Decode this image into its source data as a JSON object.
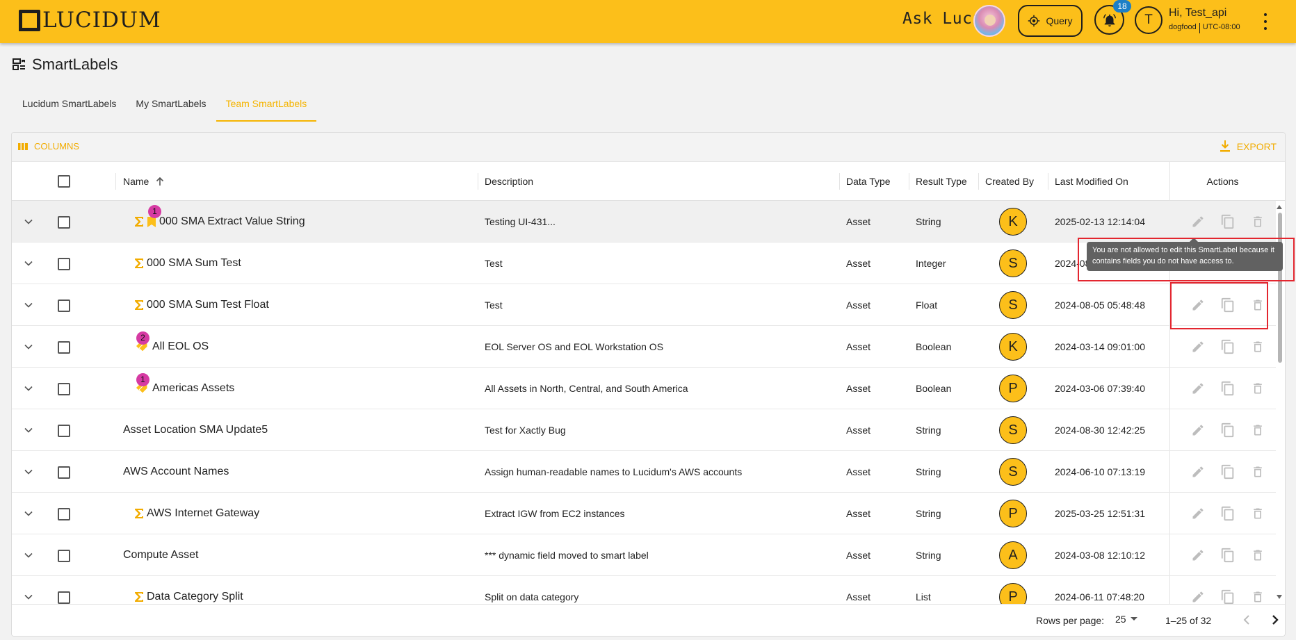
{
  "header": {
    "brand": "LUCIDUM",
    "ask_luci": "Ask Luci:",
    "query_label": "Query",
    "notification_count": "18",
    "user_initial": "T",
    "greeting": "Hi, Test_api",
    "org": "dogfood",
    "timezone": "UTC-08:00"
  },
  "page": {
    "title": "SmartLabels"
  },
  "tabs": [
    {
      "label": "Lucidum SmartLabels"
    },
    {
      "label": "My SmartLabels"
    },
    {
      "label": "Team SmartLabels",
      "active": true
    }
  ],
  "toolbar": {
    "columns_label": "COLUMNS",
    "export_label": "EXPORT"
  },
  "columns": {
    "name": "Name",
    "description": "Description",
    "data_type": "Data Type",
    "result_type": "Result Type",
    "created_by": "Created By",
    "last_modified": "Last Modified On",
    "actions": "Actions"
  },
  "rows": [
    {
      "name": "000 SMA Extract Value String",
      "description": "Testing UI-431...",
      "data_type": "Asset",
      "result_type": "String",
      "created_by": "K",
      "modified": "2025-02-13 12:14:04",
      "sigma": true,
      "bookmark": true,
      "badge": "1"
    },
    {
      "name": "000 SMA Sum Test",
      "description": "Test",
      "data_type": "Asset",
      "result_type": "Integer",
      "created_by": "S",
      "modified": "2024-08-05 05:46:12",
      "sigma": true
    },
    {
      "name": "000 SMA Sum Test Float",
      "description": "Test",
      "data_type": "Asset",
      "result_type": "Float",
      "created_by": "S",
      "modified": "2024-08-05 05:48:48",
      "sigma": true
    },
    {
      "name": "All EOL OS",
      "description": "EOL Server OS and EOL Workstation OS",
      "data_type": "Asset",
      "result_type": "Boolean",
      "created_by": "K",
      "modified": "2024-03-14 09:01:00",
      "tags": true,
      "badge": "2"
    },
    {
      "name": "Americas Assets",
      "description": "All Assets in North, Central, and South America",
      "data_type": "Asset",
      "result_type": "Boolean",
      "created_by": "P",
      "modified": "2024-03-06 07:39:40",
      "tags": true,
      "badge": "1"
    },
    {
      "name": "Asset Location SMA Update5",
      "description": "Test for Xactly Bug",
      "data_type": "Asset",
      "result_type": "String",
      "created_by": "S",
      "modified": "2024-08-30 12:42:25"
    },
    {
      "name": "AWS Account Names",
      "description": "Assign human-readable names to Lucidum's AWS accounts",
      "data_type": "Asset",
      "result_type": "String",
      "created_by": "S",
      "modified": "2024-06-10 07:13:19"
    },
    {
      "name": "AWS Internet Gateway",
      "description": "Extract IGW from EC2 instances",
      "data_type": "Asset",
      "result_type": "String",
      "created_by": "P",
      "modified": "2025-03-25 12:51:31",
      "sigma": true
    },
    {
      "name": "Compute Asset",
      "description": "*** dynamic field moved to smart label",
      "data_type": "Asset",
      "result_type": "String",
      "created_by": "A",
      "modified": "2024-03-08 12:10:12"
    },
    {
      "name": "Data Category Split",
      "description": "Split on data category",
      "data_type": "Asset",
      "result_type": "List",
      "created_by": "P",
      "modified": "2024-06-11 07:48:20",
      "sigma": true
    }
  ],
  "tooltip": {
    "text": "You are not allowed to edit this SmartLabel because it contains fields you do not have access to."
  },
  "pagination": {
    "rows_per_page_label": "Rows per page:",
    "rows_per_page": "25",
    "range": "1–25 of 32"
  },
  "colors": {
    "brand": "#fcbf1a",
    "accent": "#f5b400",
    "badge_pink": "#d63aa3",
    "badge_blue": "#1d7fc6",
    "highlight_red": "#e3262f"
  }
}
